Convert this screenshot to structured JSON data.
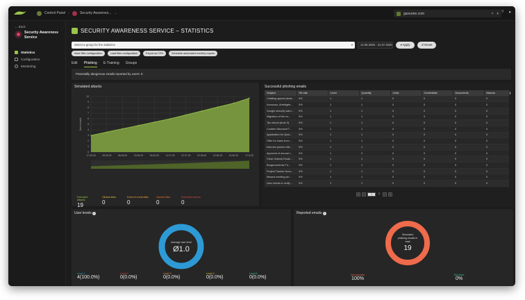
{
  "topbar": {
    "breadcrumb_root": "Control Panel",
    "breadcrumb_service": "Security Awarenes...",
    "account": "gavuone.com"
  },
  "sidebar": {
    "back_label": "Back",
    "service_name": "Security Awareness Service",
    "items": [
      {
        "label": "Statistics",
        "active": true
      },
      {
        "label": "Configuration",
        "active": false
      },
      {
        "label": "Monitoring",
        "active": false
      }
    ]
  },
  "page": {
    "title": "SECURITY AWARENESS SERVICE – STATISTICS",
    "group_placeholder": "Select a group for the statistics",
    "date_range": "12.05.2025 - 31.07.2025",
    "apply_label": "Apply",
    "reset_label": "Reset",
    "chips": [
      "Save filter configuration",
      "Load filter configuration",
      "Export as CSV",
      "Schedule automated monthly reports"
    ],
    "tabs": [
      {
        "label": "Edit",
        "active": false
      },
      {
        "label": "Phishing",
        "active": true
      },
      {
        "label": "E-Training",
        "active": false
      },
      {
        "label": "Groups",
        "active": false
      }
    ],
    "notice": "Potentially dangerous emails reported by users: 0"
  },
  "attacks": {
    "title": "Simulated attacks",
    "stats": [
      {
        "label": "Executed attacks",
        "value": "19",
        "color": "#9ac44b"
      },
      {
        "label": "Clicked links",
        "value": "0",
        "color": "#e6c13d"
      },
      {
        "label": "Entered credentials",
        "value": "0",
        "color": "#e89a3a"
      },
      {
        "label": "Opened files",
        "value": "0",
        "color": "#e8753a"
      },
      {
        "label": "Executed macros",
        "value": "0",
        "color": "#e04848"
      }
    ]
  },
  "chart_data": {
    "type": "area",
    "ylabel": "Sent emails",
    "ylim": [
      0,
      10
    ],
    "y_ticks": [
      0,
      1,
      2,
      3,
      4,
      5,
      6,
      7,
      8,
      9,
      10
    ],
    "x_ticks": [
      "17.05.25",
      "28.05.25",
      "08.06.25",
      "19.06.25",
      "30.06.25",
      "11.07.25",
      "22.07.25",
      "02.08.25",
      "13.08.25",
      "24.08.25",
      "27.8.25"
    ],
    "x": [
      0,
      1,
      2,
      3,
      4,
      5,
      6,
      7,
      8,
      9,
      10
    ],
    "values": [
      3,
      3.6,
      4.2,
      4.8,
      5.4,
      6.0,
      6.7,
      7.4,
      8.1,
      8.8,
      9.7
    ],
    "color": "#7a9a3e",
    "grid": true
  },
  "phishing": {
    "title": "Successful phishing emails",
    "columns": [
      "Subject",
      "Hit rate",
      "Level",
      "Quantity",
      "Links",
      "Credentials",
      "Documents",
      "Macros"
    ],
    "rows": [
      [
        "Chatting appeal (trust...",
        "0%",
        "1",
        "1",
        "0",
        "0",
        "0",
        "0"
      ],
      [
        "Aumuuus, Arbeitgeb...",
        "0%",
        "1",
        "1",
        "0",
        "0",
        "0",
        "0"
      ],
      [
        "Google security warn...",
        "0%",
        "1",
        "1",
        "0",
        "0",
        "0",
        "0"
      ],
      [
        "Migration of the ex...",
        "0%",
        "1",
        "1",
        "0",
        "0",
        "0",
        "0"
      ],
      [
        "Tax refund (level 3)",
        "0%",
        "1",
        "1",
        "0",
        "0",
        "0",
        "0"
      ],
      [
        "Confirm Microsoft T...",
        "0%",
        "1",
        "1",
        "0",
        "0",
        "0",
        "0"
      ],
      [
        "Application for Quot...",
        "0%",
        "1",
        "1",
        "0",
        "0",
        "0",
        "0"
      ],
      [
        "Offer for loans from ...",
        "0%",
        "1",
        "1",
        "0",
        "0",
        "0",
        "0"
      ],
      [
        "Internes persch mitt...",
        "0%",
        "1",
        "1",
        "0",
        "0",
        "0",
        "0"
      ],
      [
        "Approval of annual t...",
        "0%",
        "1",
        "2",
        "0",
        "0",
        "0",
        "0"
      ],
      [
        "Clear Outlook Email ...",
        "0%",
        "1",
        "1",
        "0",
        "0",
        "0",
        "0"
      ],
      [
        "Bürgeroeichnis Fü...",
        "0%",
        "1",
        "1",
        "0",
        "0",
        "0",
        "0"
      ],
      [
        "Project Tracker Acco...",
        "0%",
        "1",
        "1",
        "0",
        "0",
        "0",
        "0"
      ],
      [
        "Missed meeting wh...",
        "0%",
        "1",
        "1",
        "0",
        "0",
        "0",
        "0"
      ],
      [
        "User needs to verify ...",
        "0%",
        "1",
        "1",
        "0",
        "0",
        "0",
        "0"
      ]
    ],
    "pages": [
      "1",
      "2"
    ],
    "current_page": "1"
  },
  "user_levels": {
    "title": "User levels",
    "ring_label": "Average user level",
    "ring_value": "Ø1.0",
    "ring_color": "#2d9ad6",
    "levels": [
      {
        "label": "Level 1",
        "value": "4(100.0%)",
        "color": "#2d9ad6"
      },
      {
        "label": "Level 2",
        "value": "0(0.0%)",
        "color": "#e04848"
      },
      {
        "label": "Level 3",
        "value": "0(0.0%)",
        "color": "#e89a3a"
      },
      {
        "label": "Level 4",
        "value": "0(0.0%)",
        "color": "#e6c13d"
      },
      {
        "label": "Level 5",
        "value": "0(0.0%)",
        "color": "#3cc08a"
      }
    ]
  },
  "reported": {
    "title": "Reported emails",
    "ring_label_1": "Simulated",
    "ring_label_2": "phishing emails in",
    "ring_label_3": "total",
    "ring_value": "19",
    "ring_color": "#ef6b4b",
    "not_reported_label": "Not reported",
    "not_reported_value": "100%",
    "reported_label": "Reported",
    "reported_value": "0%"
  }
}
